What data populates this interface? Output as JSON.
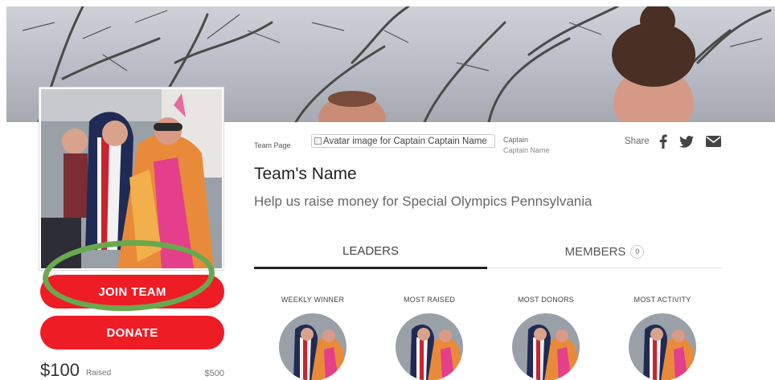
{
  "team_page_label": "Team Page",
  "avatar_alt_text": "Avatar image for Captain Captain Name",
  "captain": {
    "role": "Captain",
    "name": "Captain Name"
  },
  "share": {
    "label": "Share",
    "icons": [
      "facebook-icon",
      "twitter-icon",
      "email-icon"
    ]
  },
  "team": {
    "name": "Team's Name",
    "description": "Help us raise money for Special Olympics Pennsylvania"
  },
  "buttons": {
    "join": "JOIN TEAM",
    "donate": "DONATE"
  },
  "fundraising": {
    "raised": "$100",
    "raised_label": "Raised",
    "goal": "$500"
  },
  "tabs": [
    {
      "label": "LEADERS",
      "active": true
    },
    {
      "label": "MEMBERS",
      "count": "0",
      "active": false
    }
  ],
  "leaders": [
    {
      "label": "WEEKLY WINNER"
    },
    {
      "label": "MOST RAISED"
    },
    {
      "label": "MOST DONORS"
    },
    {
      "label": "MOST ACTIVITY"
    }
  ],
  "colors": {
    "primary_red": "#ee1c25",
    "highlight_green": "#6aa84f"
  }
}
